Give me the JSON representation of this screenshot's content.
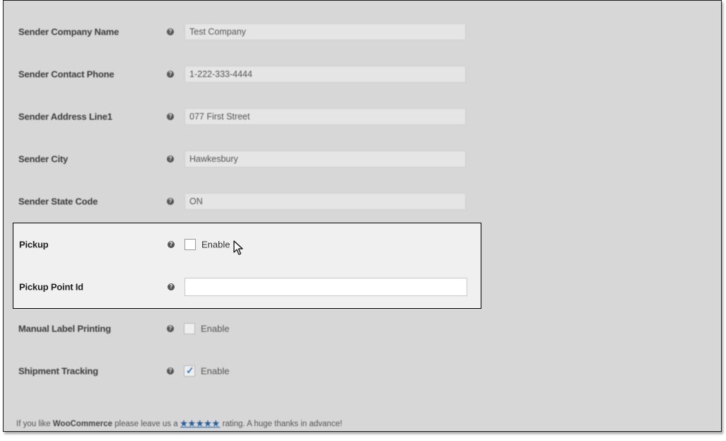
{
  "fields": [
    {
      "label": "Sender Company Name",
      "value": "Test Company"
    },
    {
      "label": "Sender Contact Phone",
      "value": "1-222-333-4444"
    },
    {
      "label": "Sender Address Line1",
      "value": "077 First Street"
    },
    {
      "label": "Sender City",
      "value": "Hawkesbury"
    },
    {
      "label": "Sender State Code",
      "value": "ON"
    }
  ],
  "pickup": {
    "label": "Pickup",
    "checkbox_label": "Enable",
    "checked": false
  },
  "pickup_point": {
    "label": "Pickup Point Id",
    "value": ""
  },
  "manual_label": {
    "label": "Manual Label Printing",
    "checkbox_label": "Enable",
    "checked": false
  },
  "shipment_tracking": {
    "label": "Shipment Tracking",
    "checkbox_label": "Enable",
    "checked": true
  },
  "help_icon_glyph": "?",
  "footer": {
    "prefix": "If you like",
    "brand": "WooCommerce",
    "middle": "please leave us a",
    "stars": "★★★★★",
    "suffix": "rating. A huge thanks in advance!"
  }
}
